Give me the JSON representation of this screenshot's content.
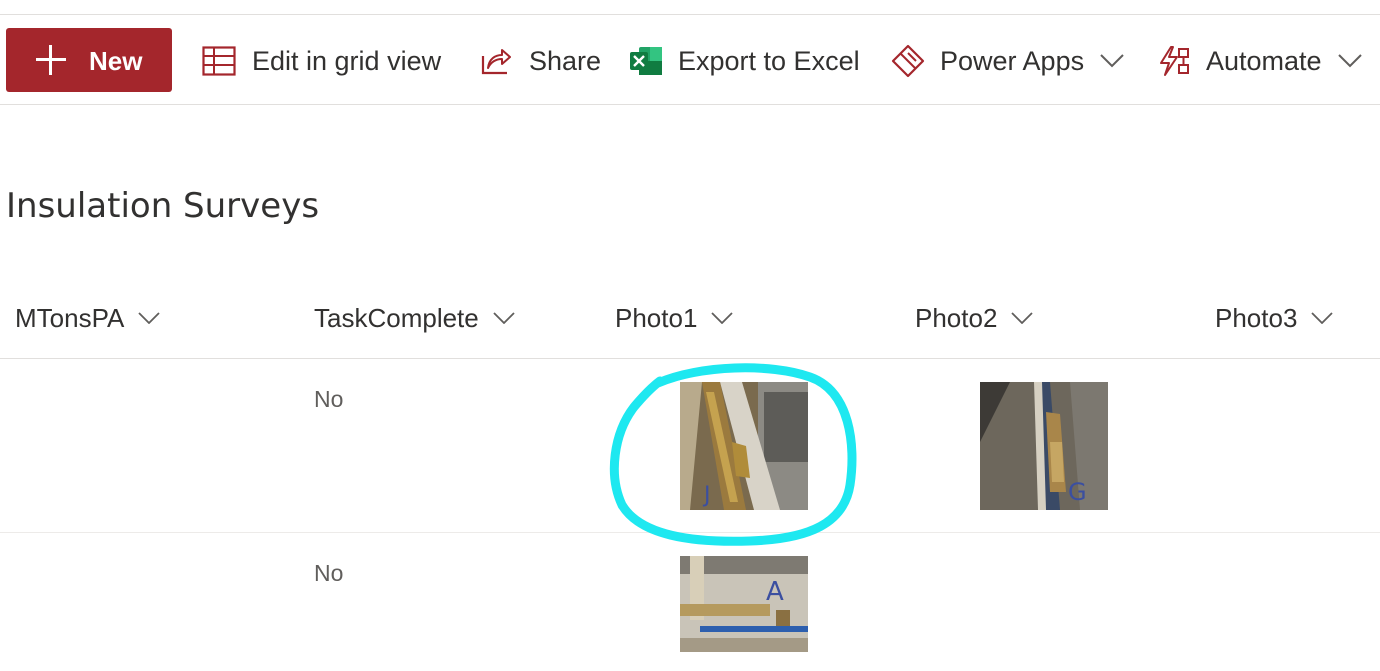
{
  "toolbar": {
    "new_label": "New",
    "edit_grid_label": "Edit in grid view",
    "share_label": "Share",
    "export_label": "Export to Excel",
    "powerapps_label": "Power Apps",
    "automate_label": "Automate"
  },
  "list": {
    "title": "Insulation Surveys",
    "columns": [
      "MTonsPA",
      "TaskComplete",
      "Photo1",
      "Photo2",
      "Photo3"
    ],
    "rows": [
      {
        "MTonsPA": "",
        "TaskComplete": "No",
        "photo1_letter": "J",
        "photo2_letter": "G"
      },
      {
        "MTonsPA": "",
        "TaskComplete": "No",
        "photo1_letter": "A"
      }
    ]
  },
  "colors": {
    "brand": "#a4262c",
    "annotation": "#1ee8f0",
    "excel": "#107c41"
  }
}
